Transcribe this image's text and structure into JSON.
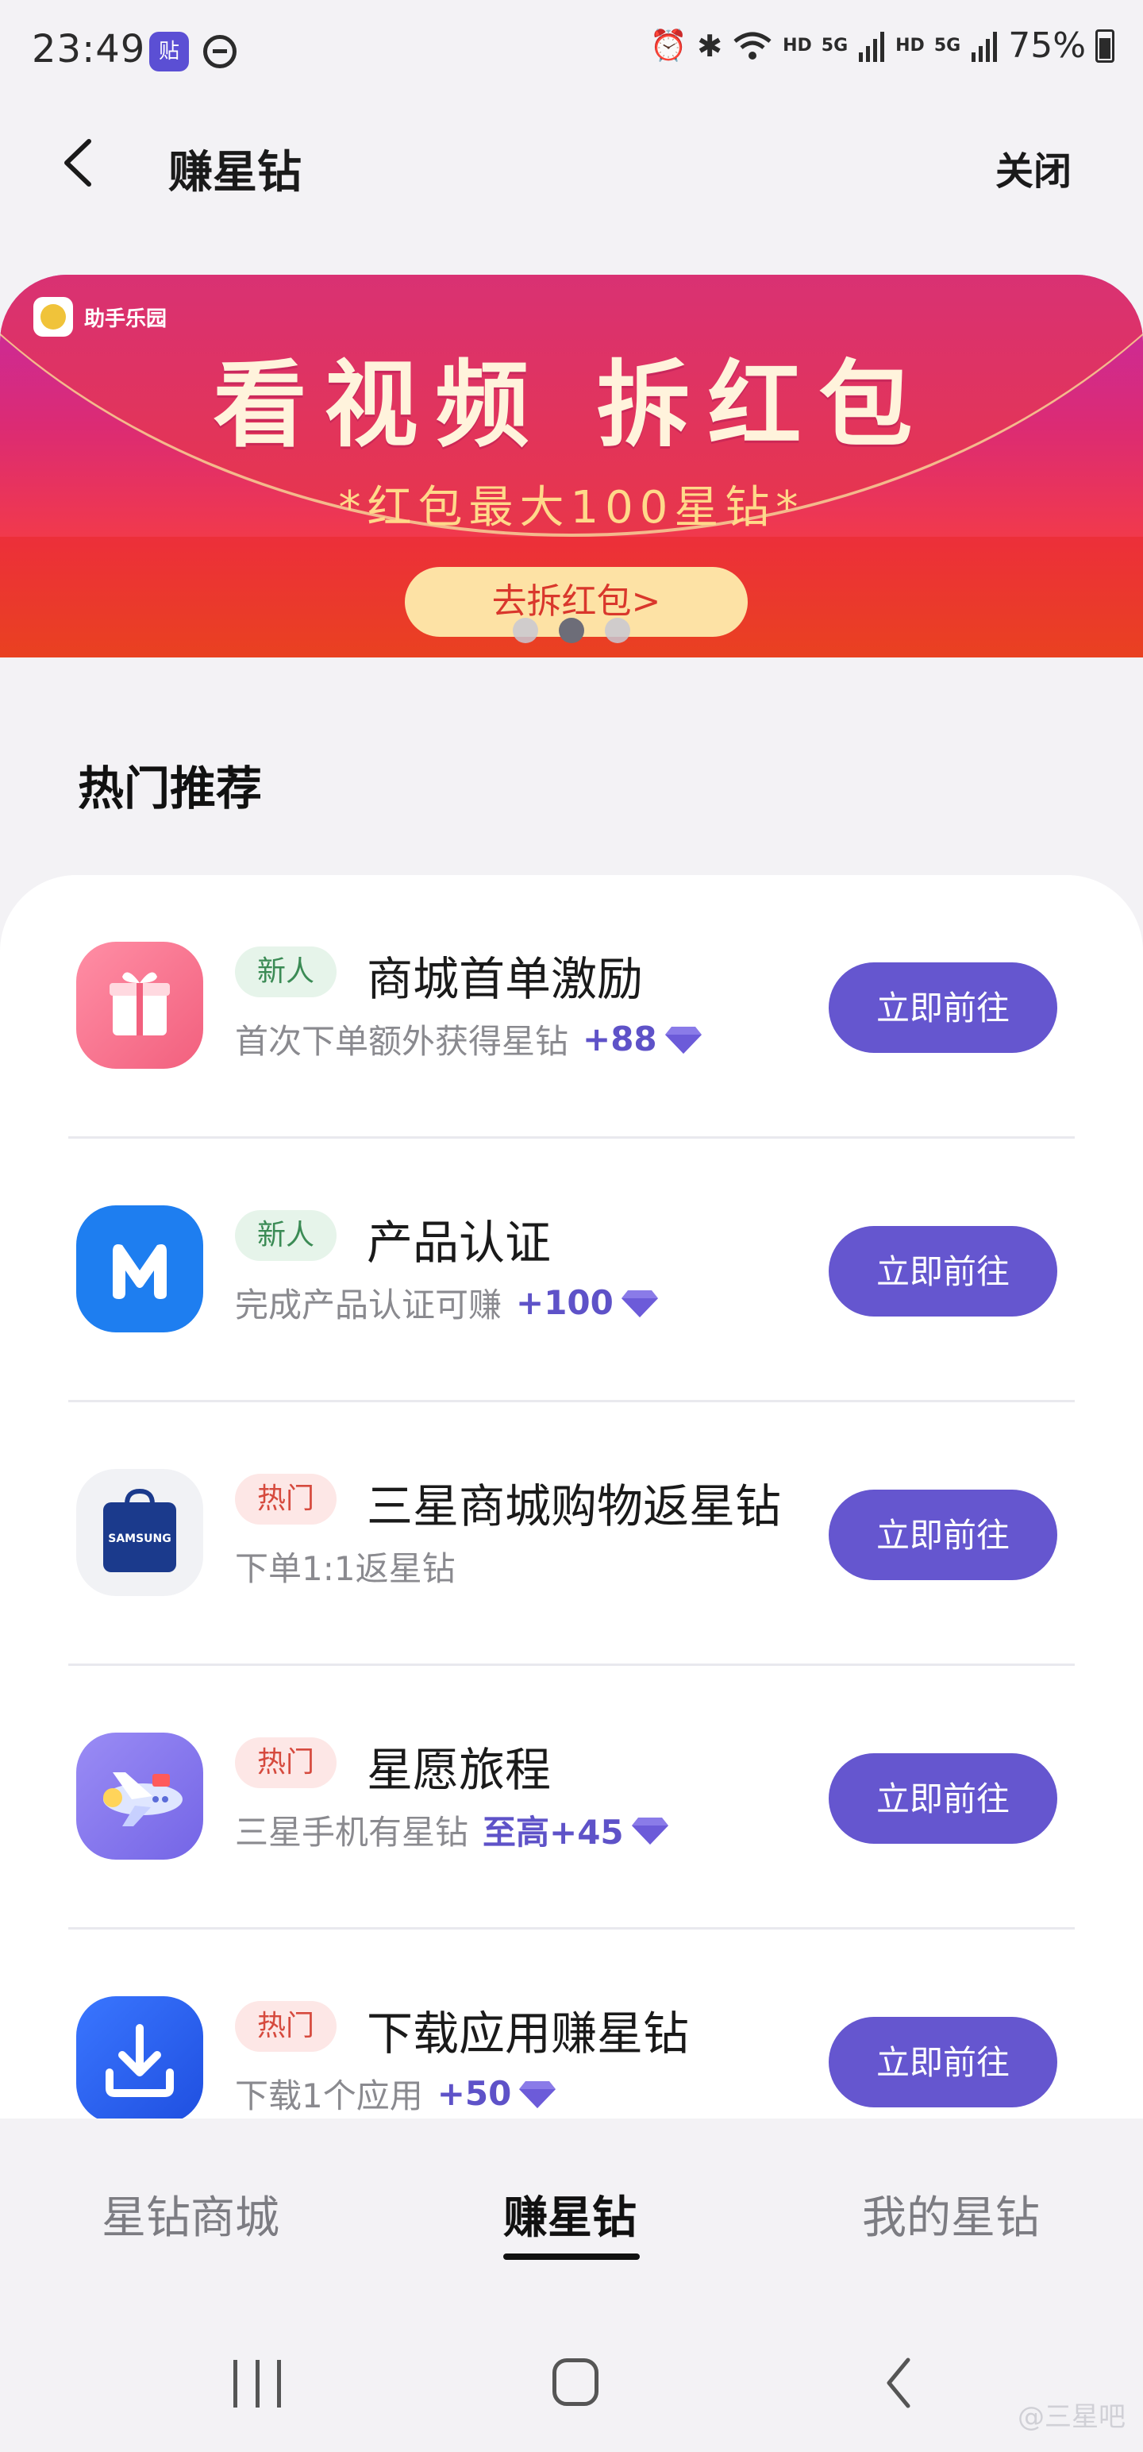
{
  "status_bar": {
    "time": "23:49",
    "app_icon_char": "贴",
    "battery": "75%",
    "hd1": "HD",
    "hd2": "HD",
    "net1": "5G",
    "net2": "5G"
  },
  "header": {
    "title": "赚星钻",
    "close_label": "关闭"
  },
  "banner": {
    "logo_text": "助手乐园",
    "headline": "看视频  拆红包",
    "subtitle": "*红包最大100星钻*",
    "cta": "去拆红包>",
    "slide_count": 3,
    "active_slide": 2
  },
  "section": {
    "title": "热门推荐"
  },
  "tasks": [
    {
      "badge": "新人",
      "title": "商城首单激励",
      "desc": "首次下单额外获得星钻",
      "reward": "+88",
      "button": "立即前往",
      "icon": "gift-icon"
    },
    {
      "badge": "新人",
      "title": "产品认证",
      "desc": "完成产品认证可赚",
      "reward": "+100",
      "button": "立即前往",
      "icon": "members-m-icon"
    },
    {
      "badge": "热门",
      "title": "三星商城购物返星钻",
      "desc": "下单1:1返星钻",
      "reward": "",
      "button": "立即前往",
      "icon": "samsung-bag-icon"
    },
    {
      "badge": "热门",
      "title": "星愿旅程",
      "desc": "三星手机有星钻",
      "reward": "至高+45",
      "button": "立即前往",
      "icon": "airplane-icon"
    },
    {
      "badge": "热门",
      "title": "下载应用赚星钻",
      "desc": "下载1个应用",
      "reward": "+50",
      "button": "立即前往",
      "icon": "download-icon"
    }
  ],
  "bottom_nav": {
    "tabs": [
      "星钻商城",
      "赚星钻",
      "我的星钻"
    ],
    "active": 1
  },
  "watermark": "@三星吧",
  "colors": {
    "accent": "#6556cf",
    "badge_new": "#3b8b55",
    "badge_hot": "#d64a3e"
  }
}
